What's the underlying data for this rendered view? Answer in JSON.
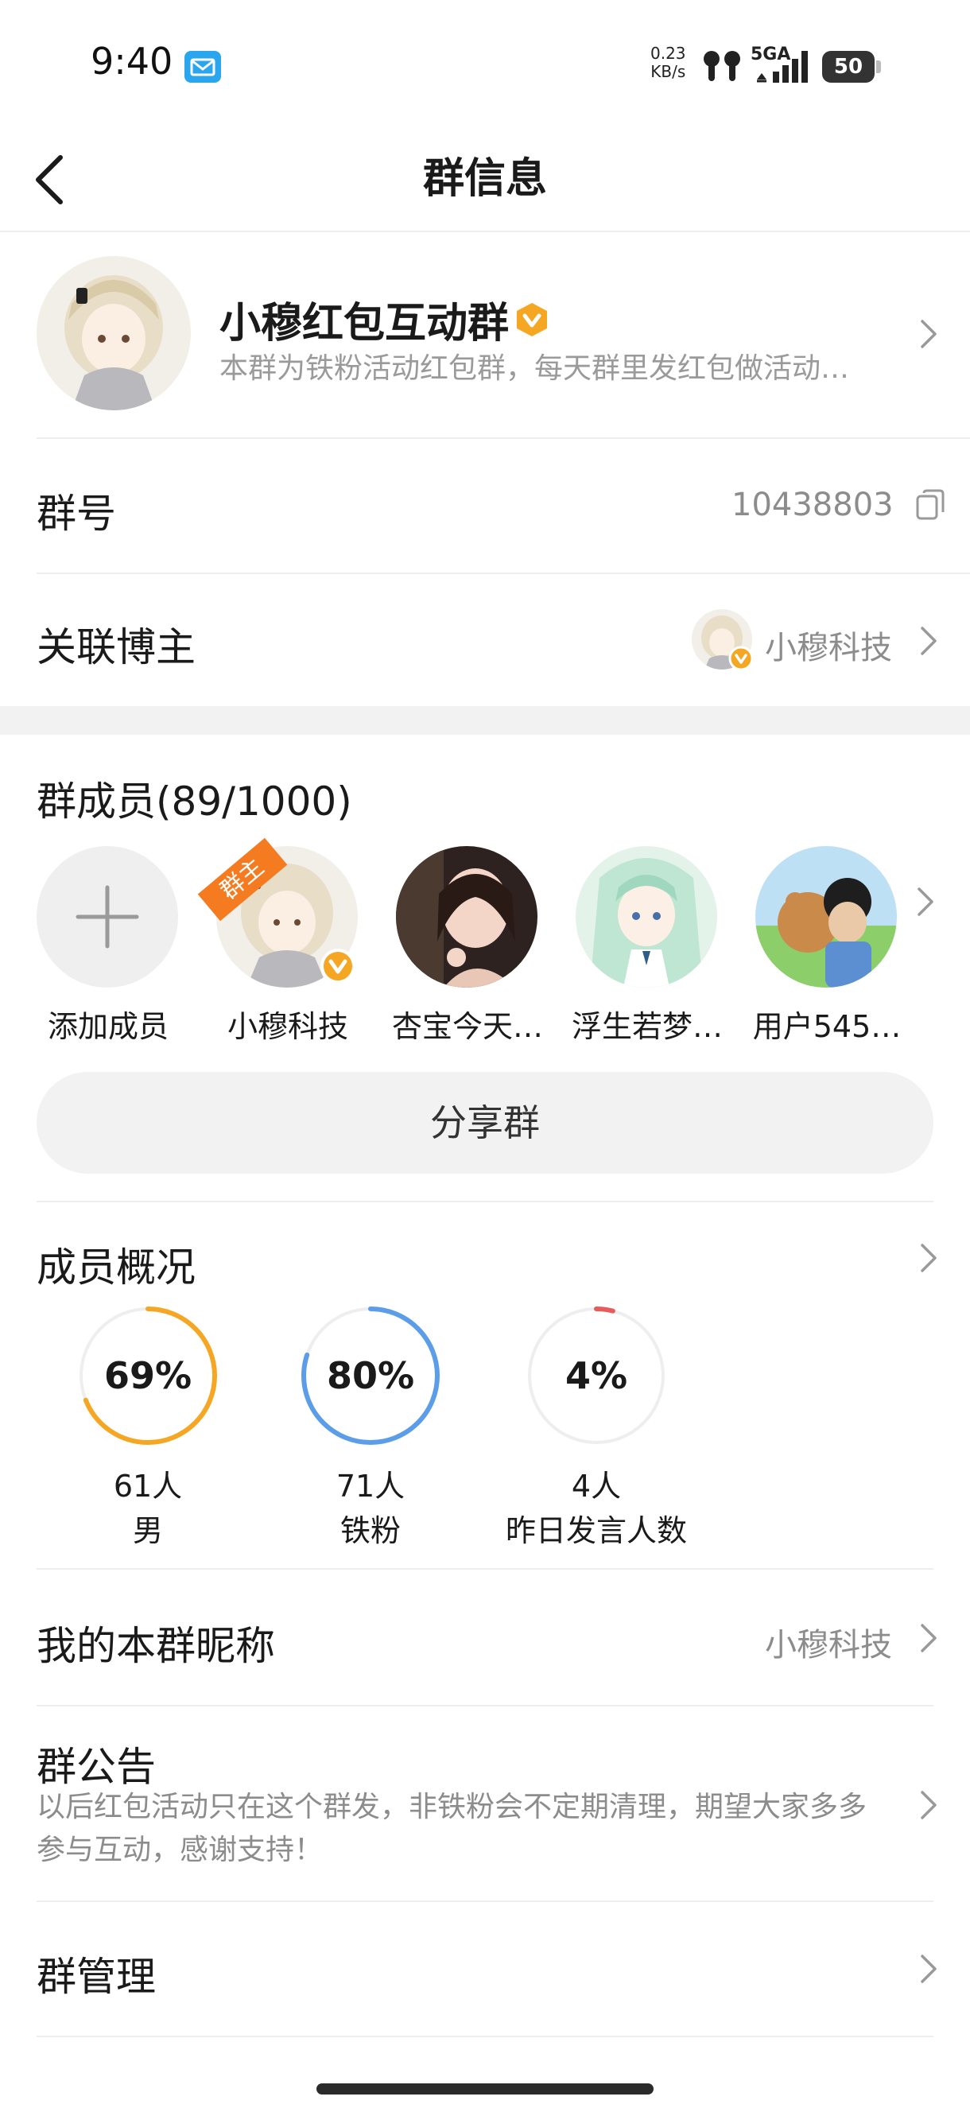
{
  "status_bar": {
    "time": "9:40",
    "net_speed_value": "0.23",
    "net_speed_unit": "KB/s",
    "network": "5GA",
    "battery": "50",
    "battery_level": 0.5
  },
  "nav": {
    "title": "群信息"
  },
  "group": {
    "name": "小穆红包互动群",
    "description": "本群为铁粉活动红包群，每天群里发红包做活动…"
  },
  "group_id": {
    "label": "群号",
    "value": "10438803"
  },
  "linked_blogger": {
    "label": "关联博主",
    "name": "小穆科技"
  },
  "members": {
    "title": "群成员(89/1000)",
    "owner_tag": "群主",
    "items": [
      {
        "name": "添加成员"
      },
      {
        "name": "小穆科技"
      },
      {
        "name": "杏宝今天…"
      },
      {
        "name": "浮生若梦…"
      },
      {
        "name": "用户545…"
      }
    ]
  },
  "share_button": "分享群",
  "overview": {
    "title": "成员概况",
    "stats": [
      {
        "percent": "69%",
        "value": 0.69,
        "count": "61人",
        "label": "男",
        "color": "#f5a623"
      },
      {
        "percent": "80%",
        "value": 0.8,
        "count": "71人",
        "label": "铁粉",
        "color": "#5b9de8"
      },
      {
        "percent": "4%",
        "value": 0.04,
        "count": "4人",
        "label": "昨日发言人数",
        "color": "#e95b5b"
      }
    ]
  },
  "nickname": {
    "label": "我的本群昵称",
    "value": "小穆科技"
  },
  "notice": {
    "label": "群公告",
    "text": "以后红包活动只在这个群发，非铁粉会不定期清理，期望大家多多参与互动，感谢支持！"
  },
  "management": {
    "label": "群管理"
  },
  "colors": {
    "accent_orange": "#f5a623",
    "accent_blue": "#5b9de8",
    "accent_red": "#e95b5b"
  }
}
